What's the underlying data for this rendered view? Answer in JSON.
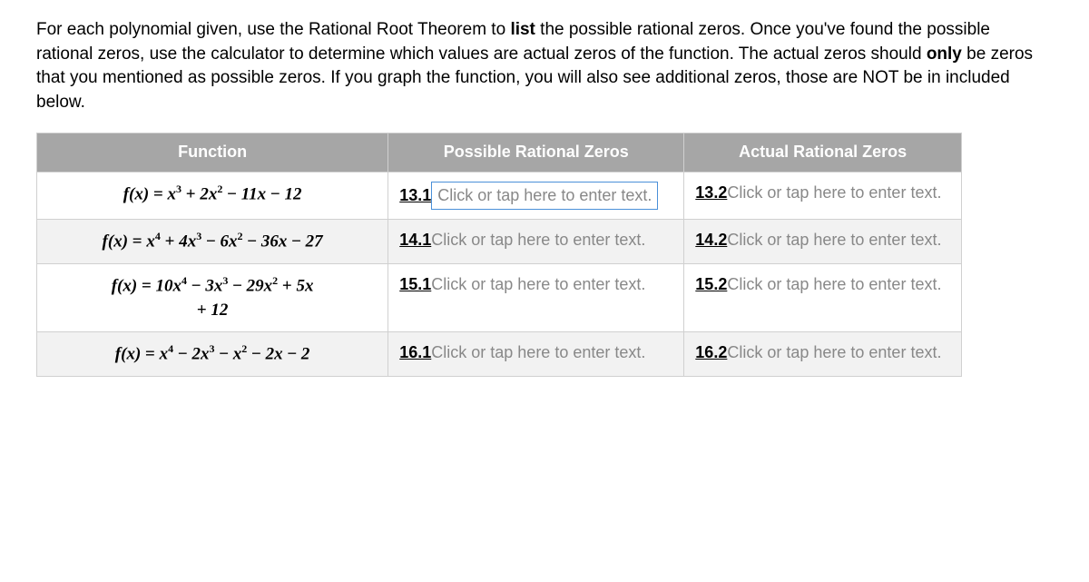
{
  "instructions": {
    "part1": "For each polynomial given, use the Rational Root Theorem to ",
    "bold1": "list",
    "part2": " the possible rational zeros. Once you've found the possible rational zeros, use the calculator to determine which values are actual zeros of the function. The actual zeros should ",
    "bold2": "only",
    "part3": " be zeros that you mentioned as possible zeros. If you graph the function, you will also see additional zeros, those are NOT be in included below."
  },
  "headers": {
    "function": "Function",
    "possible": "Possible Rational Zeros",
    "actual": "Actual Rational Zeros"
  },
  "rows": [
    {
      "shaded": false,
      "active": true,
      "possible_label": "13.1",
      "possible_placeholder": "Click or tap here to enter text.",
      "actual_label": "13.2",
      "actual_placeholder": "Click or tap here to enter text."
    },
    {
      "shaded": true,
      "active": false,
      "possible_label": "14.1",
      "possible_placeholder": "Click or tap here to enter text.",
      "actual_label": "14.2",
      "actual_placeholder": "Click or tap here to enter text."
    },
    {
      "shaded": false,
      "active": false,
      "possible_label": "15.1",
      "possible_placeholder": "Click or tap here to enter text.",
      "actual_label": "15.2",
      "actual_placeholder": "Click or tap here to enter text."
    },
    {
      "shaded": true,
      "active": false,
      "possible_label": "16.1",
      "possible_placeholder": "Click or tap here to enter text.",
      "actual_label": "16.2",
      "actual_placeholder": "Click or tap here to enter text."
    }
  ],
  "functions_html": [
    "f(x) <span class='op'>=</span> x<sup>3</sup> <span class='op'>+</span> 2x<sup>2</sup> <span class='op'>&minus;</span> 11x <span class='op'>&minus;</span> 12",
    "f(x) <span class='op'>=</span> x<sup>4</sup> <span class='op'>+</span> 4x<sup>3</sup> <span class='op'>&minus;</span> 6x<sup>2</sup> <span class='op'>&minus;</span> 36x <span class='op'>&minus;</span> 27",
    "f(x) <span class='op'>=</span> 10x<sup>4</sup> <span class='op'>&minus;</span> 3x<sup>3</sup> <span class='op'>&minus;</span> 29x<sup>2</sup> <span class='op'>+</span> 5x<br><span class='op'>+</span> 12",
    "f(x) <span class='op'>=</span> x<sup>4</sup> <span class='op'>&minus;</span> 2x<sup>3</sup> <span class='op'>&minus;</span> x<sup>2</sup> <span class='op'>&minus;</span> 2x <span class='op'>&minus;</span> 2"
  ]
}
